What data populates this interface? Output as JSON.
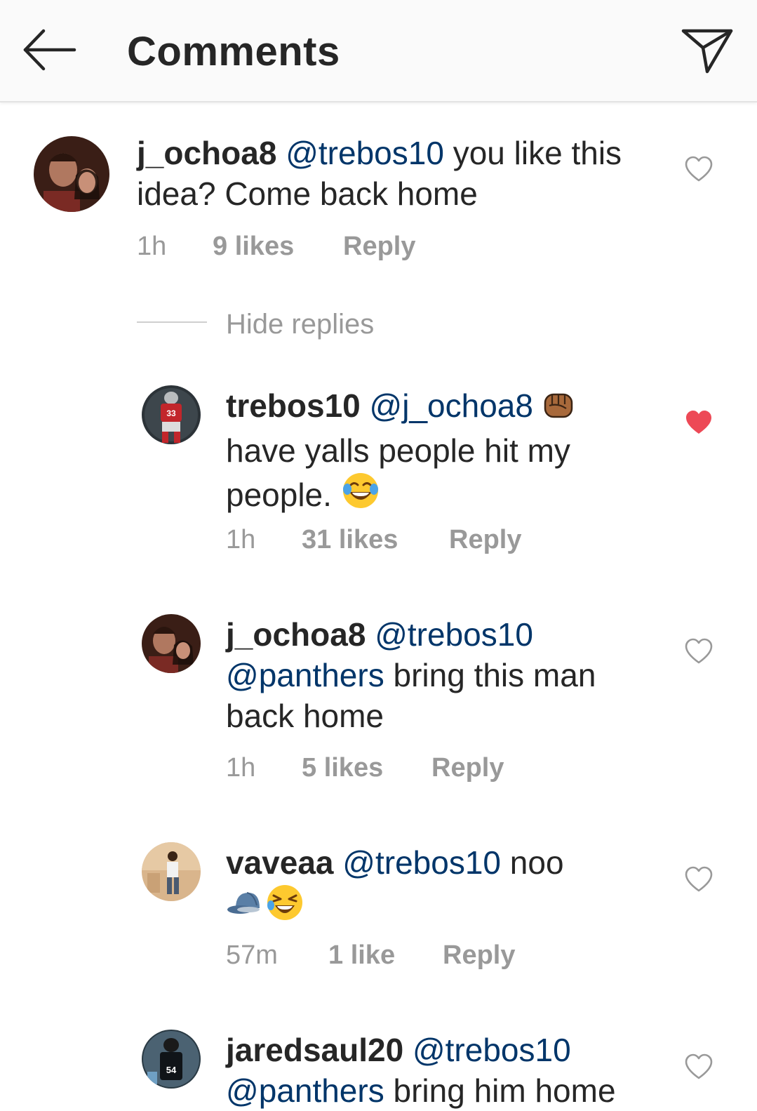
{
  "header": {
    "title": "Comments",
    "back_icon": "arrow-left-icon",
    "share_icon": "paper-plane-icon"
  },
  "comments": [
    {
      "username": "j_ochoa8",
      "mention1": "@trebos10",
      "text1": " you like this",
      "text2": "idea? Come back home",
      "time": "1h",
      "likes": "9 likes",
      "reply": "Reply",
      "liked": false
    },
    {
      "username": "trebos10",
      "mention1": "@j_ochoa8",
      "emoji1": "raised-fist-emoji",
      "text2": "have yalls people hit my",
      "text3": "people. ",
      "emoji2": "tears-of-joy-emoji",
      "time": "1h",
      "likes": "31 likes",
      "reply": "Reply",
      "liked": true
    },
    {
      "username": "j_ochoa8",
      "mention1": "@trebos10",
      "mention2": "@panthers",
      "text2": " bring this man",
      "text3": "back home",
      "time": "1h",
      "likes": "5 likes",
      "reply": "Reply",
      "liked": false
    },
    {
      "username": "vaveaa",
      "mention1": "@trebos10",
      "text1": " noo",
      "emoji1": "billed-cap-emoji",
      "emoji2": "laughing-squint-emoji",
      "time": "57m",
      "likes": "1 like",
      "reply": "Reply",
      "liked": false
    },
    {
      "username": "jaredsaul20",
      "mention1": "@trebos10",
      "mention2": "@panthers",
      "text2": " bring him home",
      "liked": false
    }
  ],
  "replies_toggle": "Hide replies",
  "colors": {
    "mention": "#003569",
    "meta": "#999999",
    "heart_liked": "#ed4956",
    "heart_outline": "#999999"
  }
}
